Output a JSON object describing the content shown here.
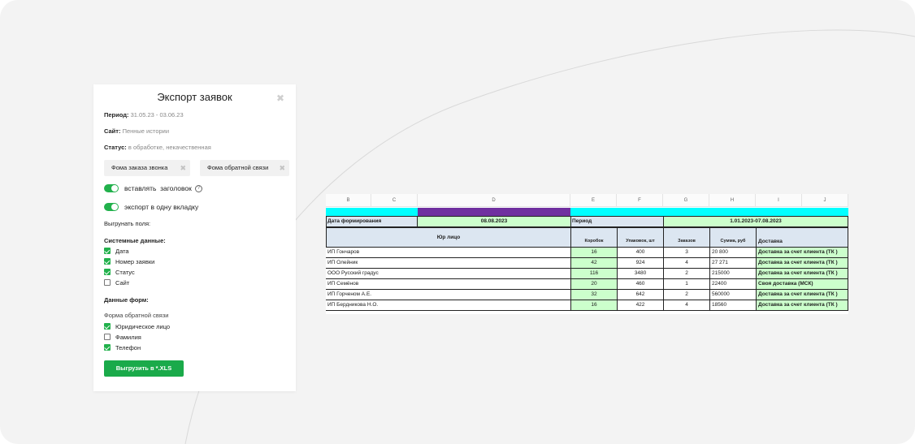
{
  "modal": {
    "title": "Экспорт заявок",
    "close_icon": "close-icon",
    "period_label": "Период:",
    "period_value": "31.05.23 - 03.06.23",
    "site_label": "Сайт:",
    "site_value": "Пенные истории",
    "status_label": "Статус:",
    "status_value": "в обработке, некачественная",
    "chips": [
      "Фома заказа звонка",
      "Фома обратной связи"
    ],
    "toggles": [
      {
        "label": "вставлять  заголовок",
        "on": true
      },
      {
        "label": "экспорт в одну вкладку",
        "on": true
      }
    ],
    "fields_label": "Выгрунать поля:",
    "system_label": "Системные данные:",
    "system_fields": [
      {
        "label": "Дата",
        "checked": true
      },
      {
        "label": "Номер заявки",
        "checked": true
      },
      {
        "label": "Статус",
        "checked": true
      },
      {
        "label": "Сайт",
        "checked": false
      }
    ],
    "form_data_label": "Данные форм:",
    "form_name": "Форма обратной связи",
    "form_fields": [
      {
        "label": "Юридическое лицо",
        "checked": true
      },
      {
        "label": "Фамилия",
        "checked": false
      },
      {
        "label": "Телефон",
        "checked": true
      }
    ],
    "export_button": "Выгрузить в *.XLS"
  },
  "sheet": {
    "columns": [
      "B",
      "C",
      "D",
      "E",
      "F",
      "G",
      "H",
      "I",
      "J"
    ],
    "date_label": "Дата формирования",
    "date_value": "08.08.2023",
    "period_label": "Период",
    "period_value": "1.01.2023-07.08.2023",
    "headers": {
      "entity": "Юр лицо",
      "boxes": "Коробок",
      "packages": "Упаковок, шт",
      "orders": "Заказов",
      "sum": "Сумма, руб",
      "delivery": "Доставка"
    },
    "rows": [
      {
        "entity": "ИП Гончаров",
        "boxes": "16",
        "packages": "400",
        "orders": "3",
        "sum": "20 800",
        "delivery": "Доставка за счет клиента (ТК )"
      },
      {
        "entity": "ИП Олейник",
        "boxes": "42",
        "packages": "924",
        "orders": "4",
        "sum": "27 271",
        "delivery": "Доставка за счет клиента (ТК )"
      },
      {
        "entity": "ООО Русский градус",
        "boxes": "116",
        "packages": "3480",
        "orders": "2",
        "sum": "215000",
        "delivery": "Доставка за счет клиента (ТК )"
      },
      {
        "entity": "ИП Семёнов",
        "boxes": "20",
        "packages": "460",
        "orders": "1",
        "sum": "22400",
        "delivery": "Своя доставка (МСК)"
      },
      {
        "entity": "ИП Горченом А.Е.",
        "boxes": "32",
        "packages": "642",
        "orders": "2",
        "sum": "560000",
        "delivery": "Доставка за счет клиента (ТК )"
      },
      {
        "entity": "ИП Бердникова Н.О.",
        "boxes": "16",
        "packages": "422",
        "orders": "4",
        "sum": "18560",
        "delivery": "Доставка за счет клиента (ТК )"
      }
    ]
  }
}
